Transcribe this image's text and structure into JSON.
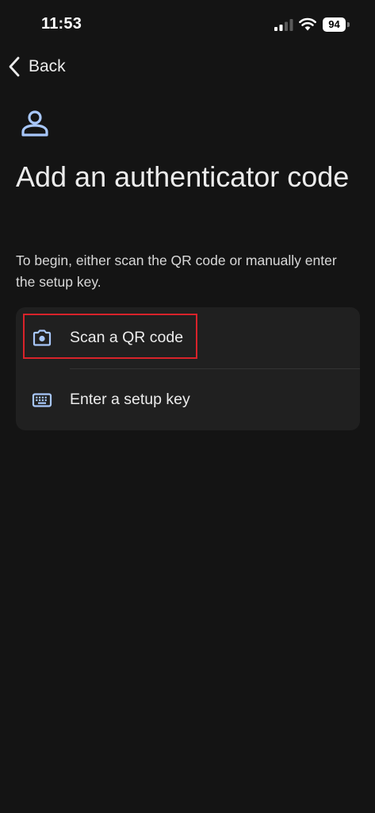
{
  "status_bar": {
    "time": "11:53",
    "battery": "94"
  },
  "nav": {
    "back_label": "Back"
  },
  "header": {
    "title": "Add an authenticator code",
    "description": "To begin, either scan the QR code or manually enter the setup key."
  },
  "options": [
    {
      "label": "Scan a QR code",
      "icon": "camera-icon"
    },
    {
      "label": "Enter a setup key",
      "icon": "keyboard-icon"
    }
  ],
  "colors": {
    "background": "#141414",
    "card": "#202020",
    "accent_icon": "#a8c7fa",
    "highlight": "#d8232a"
  }
}
